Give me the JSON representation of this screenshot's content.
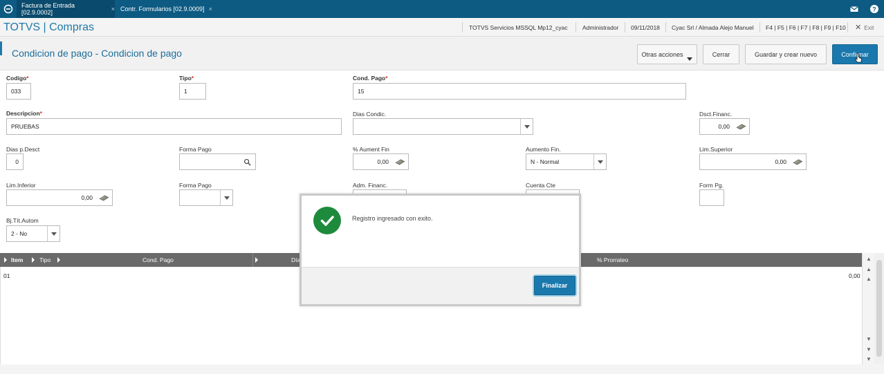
{
  "tabs": [
    {
      "label": "Factura de Entrada [02.9.0002]",
      "active": true
    },
    {
      "label": "Contr. Formularios [02.9.0009]",
      "active": false
    }
  ],
  "tab_close_glyph": "×",
  "header": {
    "logo": "TOTVS | Compras",
    "environment": "TOTVS Servicios MSSQL Mp12_cyac",
    "user": "Administrador",
    "date": "09/11/2018",
    "company": "Cyac Srl / Almada Alejo Manuel",
    "shortcuts": "F4 | F5 | F6 | F7 | F8 | F9 | F10",
    "exit_label": "Exit"
  },
  "page": {
    "title": "Condicion de pago - Condicion de pago",
    "buttons": {
      "other_actions": "Otras acciones",
      "close": "Cerrar",
      "save_new": "Guardar y crear nuevo",
      "confirm": "Confirmar"
    }
  },
  "form": {
    "codigo": {
      "label": "Codigo",
      "value": "033",
      "required": "*"
    },
    "tipo": {
      "label": "Tipo",
      "value": "1",
      "required": "*"
    },
    "cond_pago": {
      "label": "Cond. Pago",
      "value": "15",
      "required": "*"
    },
    "descripcion": {
      "label": "Descripcion",
      "value": "PRUEBAS",
      "required": "*"
    },
    "dias_condic": {
      "label": "Dias Condic.",
      "value": ""
    },
    "dsct_financ": {
      "label": "Dsct.Financ.",
      "value": "0,00"
    },
    "dias_p_desct": {
      "label": "Dias p.Desct",
      "value": "0"
    },
    "forma_pago_1": {
      "label": "Forma Pago",
      "value": ""
    },
    "aument_fin": {
      "label": "% Aument Fin",
      "value": "0,00"
    },
    "aumento_fin": {
      "label": "Aumento Fin.",
      "value": "N - Normal"
    },
    "lim_superior": {
      "label": "Lim.Superior",
      "value": "0,00"
    },
    "lim_inferior": {
      "label": "Lim.Inferior",
      "value": "0,00"
    },
    "forma_pago_2": {
      "label": "Forma Pago",
      "value": ""
    },
    "adm_financ": {
      "label": "Adm. Financ.",
      "value": ""
    },
    "cuenta_cte": {
      "label": "Cuenta Cte",
      "value": ""
    },
    "form_pg": {
      "label": "Form Pg.",
      "value": ""
    },
    "bj_tit_autom": {
      "label": "Bj.Tít.Autom",
      "value": "2 - No"
    }
  },
  "grid": {
    "columns": [
      "Item",
      "Tipo",
      "Cond. Pago",
      "Día",
      "% Prorrateo"
    ],
    "rows": [
      {
        "item": "01",
        "prorrateo": "0,00"
      }
    ]
  },
  "modal": {
    "message": "Registro ingresado con exito.",
    "button": "Finalizar"
  },
  "colors": {
    "tabbar": "#0d5a82",
    "primary": "#1a78ad",
    "success": "#1e8a3c",
    "required": "#d9302a"
  }
}
